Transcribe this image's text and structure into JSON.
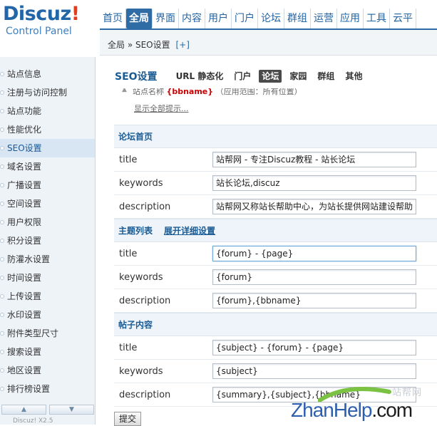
{
  "logo": {
    "brand": "Discuz",
    "bang": "!",
    "sub": "Control Panel"
  },
  "topnav": [
    "首页",
    "全局",
    "界面",
    "内容",
    "用户",
    "门户",
    "论坛",
    "群组",
    "运营",
    "应用",
    "工具",
    "云平"
  ],
  "topnav_active": 1,
  "breadcrumb": {
    "path": "全局 » SEO设置",
    "plus": "[+]"
  },
  "sidebar": {
    "items": [
      "站点信息",
      "注册与访问控制",
      "站点功能",
      "性能优化",
      "SEO设置",
      "域名设置",
      "广播设置",
      "空间设置",
      "用户权限",
      "积分设置",
      "防灌水设置",
      "时间设置",
      "上传设置",
      "水印设置",
      "附件类型尺寸",
      "搜索设置",
      "地区设置",
      "排行榜设置"
    ],
    "active": 4,
    "scroll_up": "▲",
    "scroll_down": "▼",
    "footer": "Discuz! X2.5"
  },
  "page": {
    "title": "SEO设置",
    "tabs": [
      "URL 静态化",
      "门户",
      "论坛",
      "家园",
      "群组",
      "其他"
    ],
    "active_tab": 2,
    "tip_prefix": "站点名称",
    "tip_var": "{bbname}",
    "tip_suffix": "（应用范围：所有位置）",
    "show_all": "显示全部提示..."
  },
  "sections": [
    {
      "title": "论坛首页",
      "expand": "",
      "rows": [
        {
          "label": "title",
          "value": "站帮网 - 专注Discuz教程 - 站长论坛"
        },
        {
          "label": "keywords",
          "value": "站长论坛,discuz"
        },
        {
          "label": "description",
          "value": "站帮网又称站长帮助中心，为站长提供网站建设帮助"
        }
      ]
    },
    {
      "title": "主题列表",
      "expand": "展开详细设置",
      "rows": [
        {
          "label": "title",
          "value": "{forum} - {page}",
          "focus": true
        },
        {
          "label": "keywords",
          "value": "{forum}"
        },
        {
          "label": "description",
          "value": "{forum},{bbname}"
        }
      ]
    },
    {
      "title": "帖子内容",
      "expand": "",
      "rows": [
        {
          "label": "title",
          "value": "{subject} - {forum} - {page}"
        },
        {
          "label": "keywords",
          "value": "{subject}"
        },
        {
          "label": "description",
          "value": "{summary},{subject},{bbname}"
        }
      ]
    }
  ],
  "submit_label": "提交",
  "watermark": {
    "main_a": "Zhan",
    "main_b": "Help",
    "main_c": ".com",
    "cn": "站帮网"
  },
  "colors": {
    "accent": "#2f6ca6",
    "sidebar_bg": "#eef3f8",
    "active_side": "#d8e6f3",
    "var_red": "#cc0000"
  }
}
